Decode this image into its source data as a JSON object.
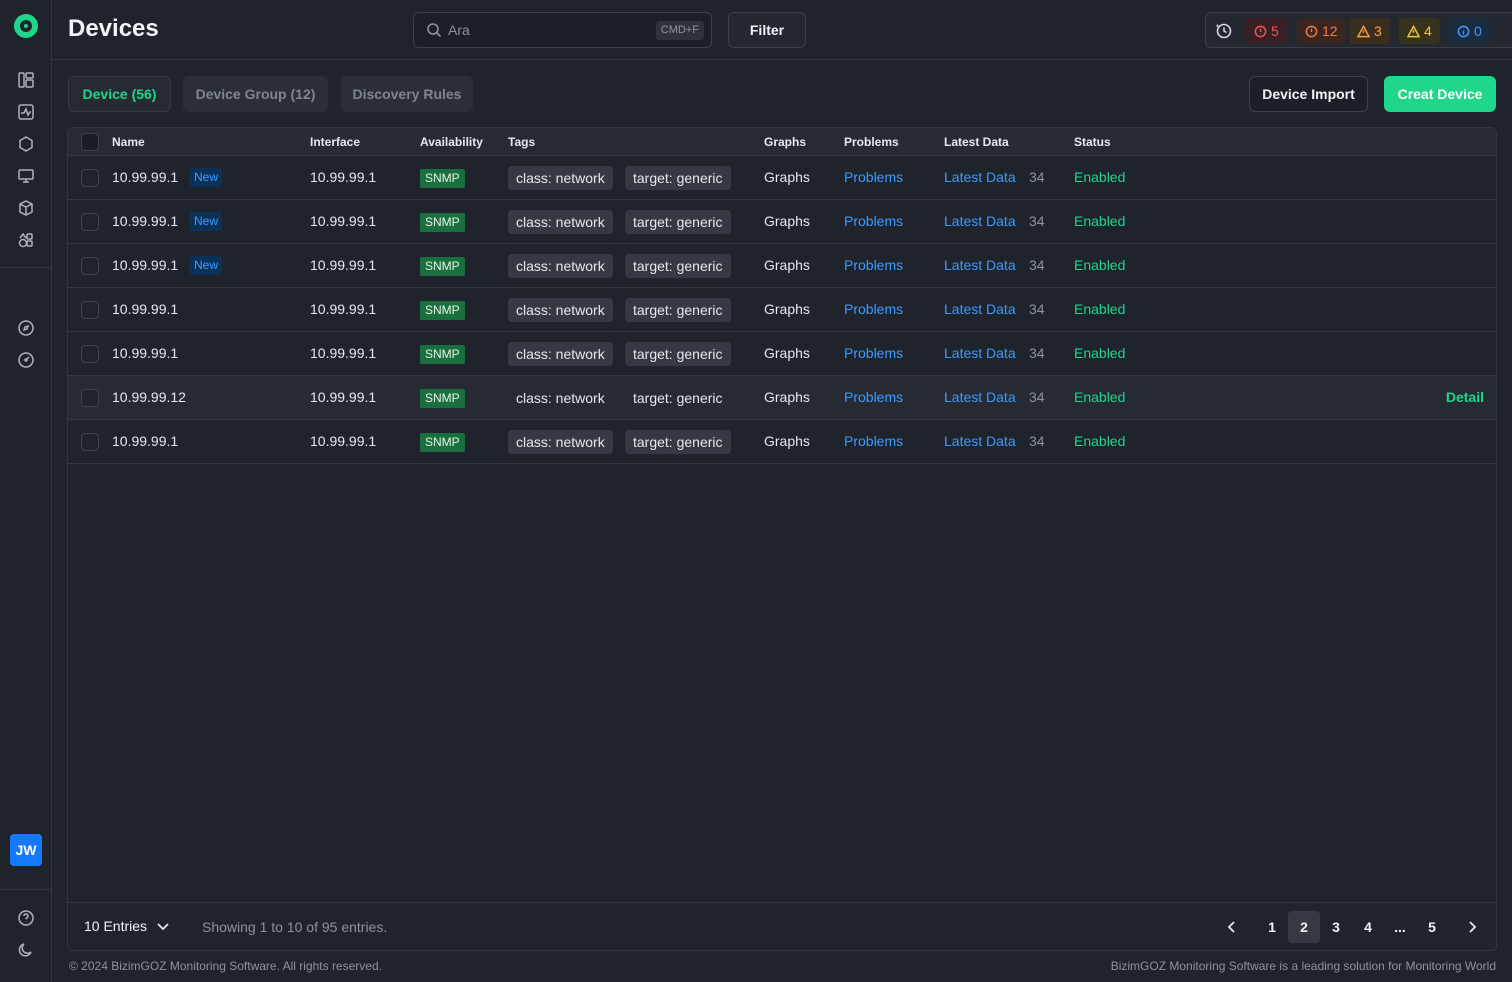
{
  "header": {
    "title": "Devices",
    "search_placeholder": "Ara",
    "search_shortcut": "CMD+F",
    "filter_label": "Filter",
    "alerts": [
      {
        "value": "5",
        "color": "#f2555a",
        "bg": "#3a2024",
        "icon": "alert-circle-icon"
      },
      {
        "value": "12",
        "color": "#f27a3d",
        "bg": "#3a2620",
        "icon": "alert-circle-icon"
      },
      {
        "value": "3",
        "color": "#f2a13d",
        "bg": "#3a2d1d",
        "icon": "warning-triangle-icon"
      },
      {
        "value": "4",
        "color": "#f2c53d",
        "bg": "#37321c",
        "icon": "warning-triangle-icon"
      },
      {
        "value": "0",
        "color": "#3b9cff",
        "bg": "#1b2b40",
        "icon": "info-circle-icon"
      }
    ]
  },
  "tabs": [
    {
      "label": "Device (56)",
      "active": true
    },
    {
      "label": "Device Group (12)",
      "active": false
    },
    {
      "label": "Discovery Rules",
      "active": false
    }
  ],
  "actions": {
    "import_label": "Device Import",
    "create_label": "Creat Device"
  },
  "table": {
    "columns": [
      "Name",
      "Interface",
      "Availability",
      "Tags",
      "Graphs",
      "Problems",
      "Latest Data",
      "Status"
    ],
    "rows": [
      {
        "name": "10.99.99.1",
        "badge": "New",
        "interface": "10.99.99.1",
        "availability": "SNMP",
        "tag1": "class: network",
        "tag2": "target: generic",
        "graphs": "Graphs",
        "problems": "Problems",
        "latest": "Latest Data",
        "count": "34",
        "status": "Enabled",
        "detail": ""
      },
      {
        "name": "10.99.99.1",
        "badge": "New",
        "interface": "10.99.99.1",
        "availability": "SNMP",
        "tag1": "class: network",
        "tag2": "target: generic",
        "graphs": "Graphs",
        "problems": "Problems",
        "latest": "Latest Data",
        "count": "34",
        "status": "Enabled",
        "detail": ""
      },
      {
        "name": "10.99.99.1",
        "badge": "New",
        "interface": "10.99.99.1",
        "availability": "SNMP",
        "tag1": "class: network",
        "tag2": "target: generic",
        "graphs": "Graphs",
        "problems": "Problems",
        "latest": "Latest Data",
        "count": "34",
        "status": "Enabled",
        "detail": ""
      },
      {
        "name": "10.99.99.1",
        "badge": "",
        "interface": "10.99.99.1",
        "availability": "SNMP",
        "tag1": "class: network",
        "tag2": "target: generic",
        "graphs": "Graphs",
        "problems": "Problems",
        "latest": "Latest Data",
        "count": "34",
        "status": "Enabled",
        "detail": ""
      },
      {
        "name": "10.99.99.1",
        "badge": "",
        "interface": "10.99.99.1",
        "availability": "SNMP",
        "tag1": "class: network",
        "tag2": "target: generic",
        "graphs": "Graphs",
        "problems": "Problems",
        "latest": "Latest Data",
        "count": "34",
        "status": "Enabled",
        "detail": ""
      },
      {
        "name": "10.99.99.12",
        "badge": "",
        "interface": "10.99.99.1",
        "availability": "SNMP",
        "tag1": "class: network",
        "tag2": "target: generic",
        "graphs": "Graphs",
        "problems": "Problems",
        "latest": "Latest Data",
        "count": "34",
        "status": "Enabled",
        "detail": "Detail",
        "highlighted": true
      },
      {
        "name": "10.99.99.1",
        "badge": "",
        "interface": "10.99.99.1",
        "availability": "SNMP",
        "tag1": "class: network",
        "tag2": "target: generic",
        "graphs": "Graphs",
        "problems": "Problems",
        "latest": "Latest Data",
        "count": "34",
        "status": "Enabled",
        "detail": ""
      }
    ]
  },
  "pagination": {
    "entries_label": "10 Entries",
    "showing": "Showing 1 to 10 of 95 entries.",
    "pages": [
      "1",
      "2",
      "3",
      "4",
      "...",
      "5"
    ],
    "current": "2"
  },
  "user": {
    "initials": "JW"
  },
  "footer": {
    "copyright": "© 2024 BizimGOZ Monitoring Software. All rights reserved.",
    "tagline": "BizimGOZ Monitoring Software is a leading solution for Monitoring World"
  },
  "colors": {
    "accent": "#1fd68a",
    "link": "#3b9cff",
    "background": "#1f232b"
  }
}
